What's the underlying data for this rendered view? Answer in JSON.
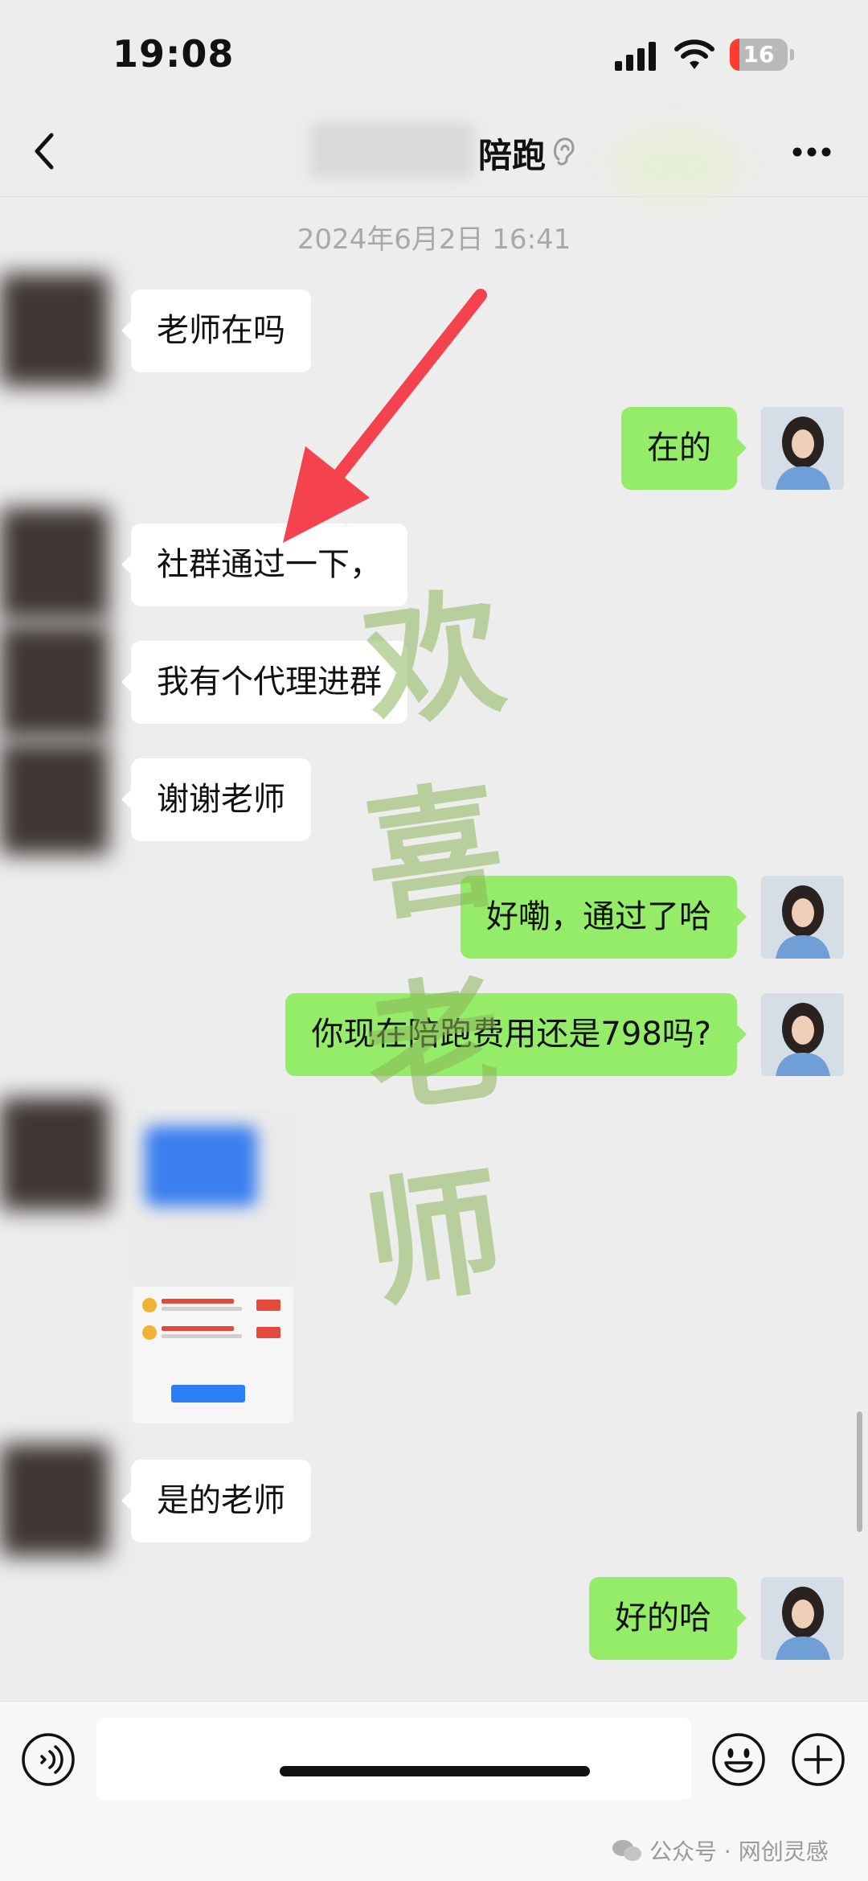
{
  "status_bar": {
    "time": "19:08",
    "battery_level": "16",
    "battery_fraction": 0.16
  },
  "nav": {
    "title": "陪跑",
    "back_icon": "chevron-left-icon",
    "ear_icon": "ear-icon",
    "more_icon": "more-dots-icon"
  },
  "chat": {
    "timestamp": "2024年6月2日 16:41",
    "messages": [
      {
        "side": "in",
        "text": "老师在吗"
      },
      {
        "side": "out",
        "text": "在的"
      },
      {
        "side": "in",
        "text": "社群通过一下，"
      },
      {
        "side": "in",
        "text": "我有个代理进群"
      },
      {
        "side": "in",
        "text": "谢谢老师"
      },
      {
        "side": "out",
        "text": "好嘞，通过了哈"
      },
      {
        "side": "out",
        "text": "你现在陪跑费用还是798吗?"
      },
      {
        "side": "in",
        "type": "image"
      },
      {
        "side": "in",
        "text": "是的老师"
      },
      {
        "side": "out",
        "text": "好的哈"
      }
    ]
  },
  "watermark_chars": [
    "欢",
    "喜",
    "老",
    "师"
  ],
  "input_bar": {
    "placeholder": "",
    "voice_icon": "voice-icon",
    "emoji_icon": "emoji-icon",
    "plus_icon": "plus-icon"
  },
  "credit": {
    "text": "公众号 · 网创灵感"
  },
  "colors": {
    "background": "#ededed",
    "bubble_out": "#95ec69",
    "bubble_in": "#ffffff",
    "arrow": "#f5424f"
  }
}
